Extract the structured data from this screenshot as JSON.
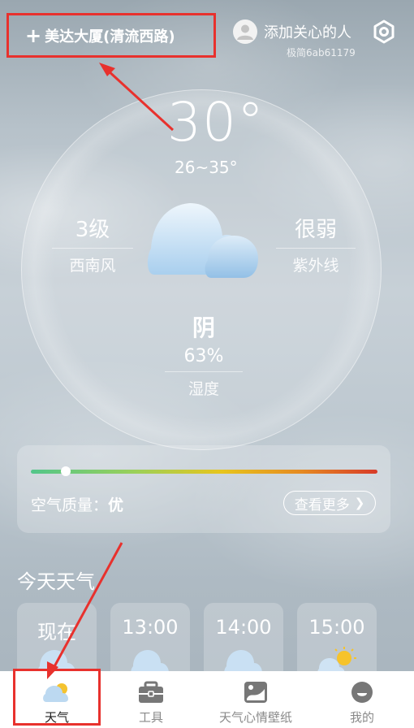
{
  "header": {
    "location": "美达大厦(清流西路)",
    "plus": "+",
    "care_label": "添加关心的人",
    "device_id": "极简6ab61179"
  },
  "weather": {
    "temperature": "30°",
    "range": "26~35°",
    "wind_level": "3级",
    "wind_direction": "西南风",
    "uv_level": "很弱",
    "uv_label": "紫外线",
    "condition": "阴",
    "humidity_value": "63%",
    "humidity_label": "湿度"
  },
  "air_quality": {
    "label": "空气质量：",
    "value": "优",
    "more_label": "查看更多",
    "level_fraction": 0.1,
    "gradient": [
      "#52c68a",
      "#9bd05a",
      "#e7c51d",
      "#e58a22",
      "#d83b29"
    ]
  },
  "today": {
    "title": "今天天气",
    "hours": [
      {
        "label": "现在",
        "icon": "cloud-icon"
      },
      {
        "label": "13:00",
        "icon": "cloud-icon"
      },
      {
        "label": "14:00",
        "icon": "cloud-icon"
      },
      {
        "label": "15:00",
        "icon": "sun-cloud-icon"
      }
    ]
  },
  "tabbar": {
    "items": [
      {
        "label": "天气",
        "icon": "weather-icon",
        "active": true
      },
      {
        "label": "工具",
        "icon": "toolbox-icon",
        "active": false
      },
      {
        "label": "天气心情壁纸",
        "icon": "wallpaper-icon",
        "active": false
      },
      {
        "label": "我的",
        "icon": "profile-icon",
        "active": false
      }
    ]
  },
  "colors": {
    "highlight": "#e8312d",
    "tab_active": "#222222",
    "tab_inactive": "#8a8a8a"
  }
}
